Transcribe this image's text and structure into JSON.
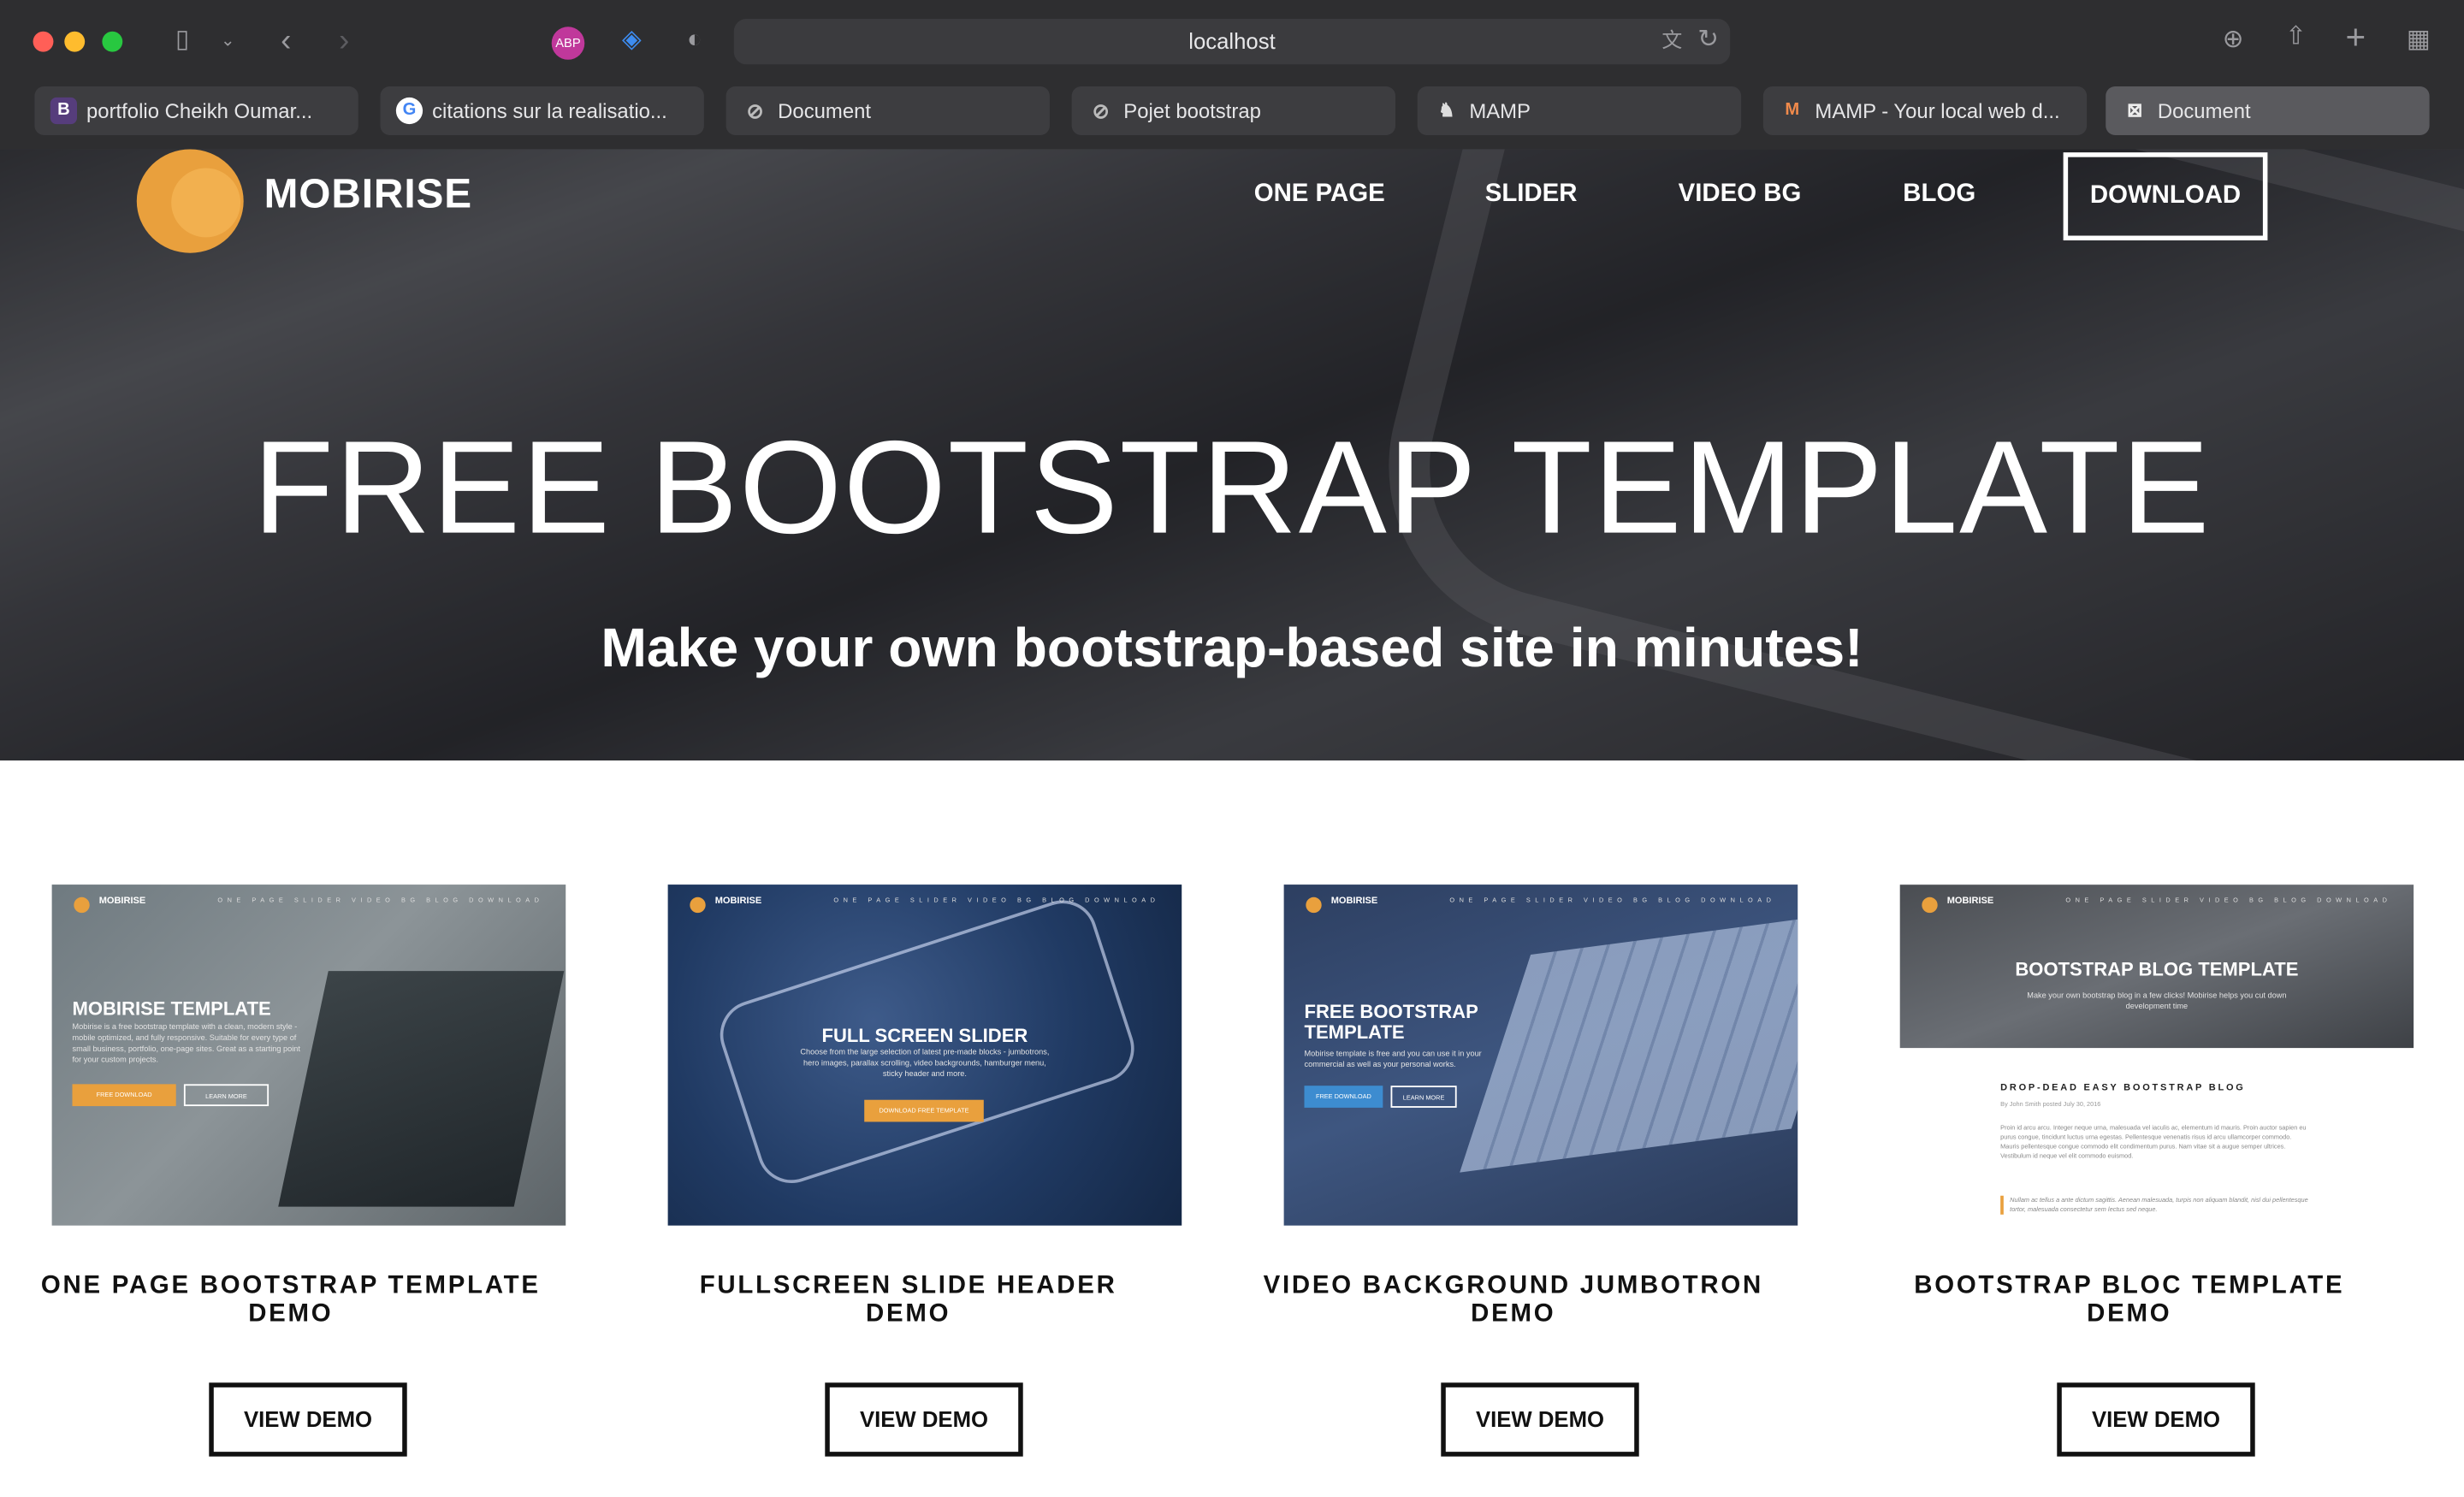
{
  "browser": {
    "url": "localhost",
    "tabs": [
      {
        "label": "portfolio Cheikh Oumar...",
        "icon": "bootstrap-icon"
      },
      {
        "label": "citations sur la realisatio...",
        "icon": "google-icon"
      },
      {
        "label": "Document",
        "icon": "compass-icon"
      },
      {
        "label": "Pojet bootstrap",
        "icon": "compass-icon"
      },
      {
        "label": "MAMP",
        "icon": "elephant-icon"
      },
      {
        "label": "MAMP - Your local web d...",
        "icon": "mamp-icon"
      },
      {
        "label": "Document",
        "icon": "document-icon"
      }
    ],
    "extension_badge": "ABP"
  },
  "navbar": {
    "brand": "MOBIRISE",
    "links": [
      "ONE PAGE",
      "SLIDER",
      "VIDEO BG",
      "BLOG"
    ],
    "download": "DOWNLOAD"
  },
  "hero": {
    "title": "FREE BOOTSTRAP TEMPLATE",
    "subtitle": "Make your own bootstrap-based site in minutes!"
  },
  "cards": [
    {
      "title": "ONE PAGE BOOTSTRAP TEMPLATE DEMO",
      "button": "VIEW DEMO",
      "thumb": {
        "brand": "MOBIRISE",
        "nav": "ONE PAGE  SLIDER  VIDEO BG  BLOG  DOWNLOAD",
        "heading": "MOBIRISE TEMPLATE",
        "text": "Mobirise is a free bootstrap template with a clean, modern style - mobile optimized, and fully responsive. Suitable for every type of small business, portfolio, one-page sites. Great as a starting point for your custom projects.",
        "btn1": "FREE DOWNLOAD",
        "btn2": "LEARN MORE"
      }
    },
    {
      "title": "FULLSCREEN SLIDE HEADER DEMO",
      "button": "VIEW DEMO",
      "thumb": {
        "brand": "MOBIRISE",
        "nav": "ONE PAGE  SLIDER  VIDEO BG  BLOG  DOWNLOAD",
        "heading": "FULL SCREEN SLIDER",
        "text": "Choose from the large selection of latest pre-made blocks - jumbotrons, hero images, parallax scrolling, video backgrounds, hamburger menu, sticky header and more.",
        "btn1": "DOWNLOAD FREE TEMPLATE"
      }
    },
    {
      "title": "VIDEO BACKGROUND JUMBOTRON DEMO",
      "button": "VIEW DEMO",
      "thumb": {
        "brand": "MOBIRISE",
        "nav": "ONE PAGE  SLIDER  VIDEO BG  BLOG  DOWNLOAD",
        "heading": "FREE BOOTSTRAP TEMPLATE",
        "text": "Mobirise template is free and you can use it in your commercial as well as your personal works.",
        "btn1": "FREE DOWNLOAD",
        "btn2": "LEARN MORE"
      }
    },
    {
      "title": "BOOTSTRAP BLOC TEMPLATE DEMO",
      "button": "VIEW DEMO",
      "thumb": {
        "brand": "MOBIRISE",
        "nav": "ONE PAGE  SLIDER  VIDEO BG  BLOG  DOWNLOAD",
        "heading": "BOOTSTRAP BLOG TEMPLATE",
        "text": "Make your own bootstrap blog in a few clicks! Mobirise helps you cut down development time",
        "post_title": "DROP-DEAD EASY BOOTSTRAP BLOG",
        "post_meta": "By John Smith posted July 30, 2016",
        "post_body": "Proin id arcu arcu. Integer neque urna, malesuada vel iaculis ac, elementum id mauris. Proin auctor sapien eu purus congue, tincidunt luctus urna egestas. Pellentesque venenatis risus id arcu ullamcorper commodo. Mauris pellentesque congue commodo elit condimentum purus. Nam vitae sit a augue semper ultrices. Vestibulum id neque vel elit commodo euismod.",
        "post_quote": "Nullam ac tellus a ante dictum sagittis. Aenean malesuada, turpis non aliquam blandit, nisl dui pellentesque tortor, malesuada consectetur sem lectus sed neque."
      }
    }
  ],
  "colors": {
    "accent": "#e9a03d",
    "chrome": "#2e2e30",
    "hero_overlay": "#2b2c30"
  }
}
